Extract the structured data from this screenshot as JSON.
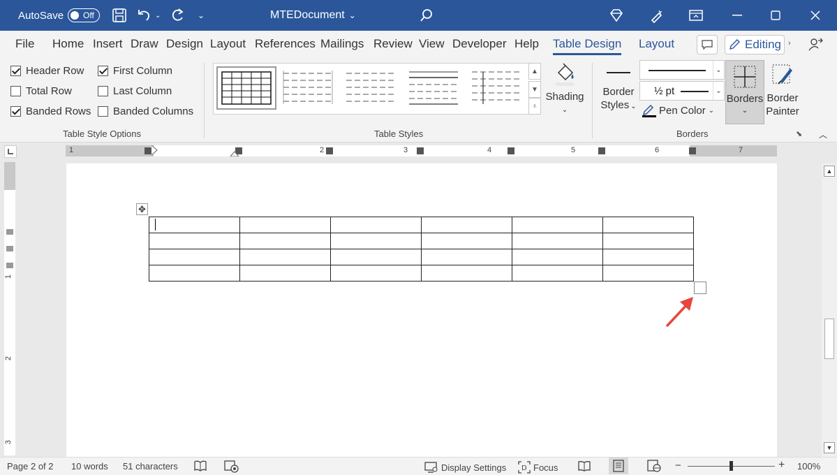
{
  "titlebar": {
    "autosave_label": "AutoSave",
    "autosave_state": "Off",
    "doc_title": "MTEDocument",
    "bg_color": "#2b579a"
  },
  "menu": {
    "tabs": [
      "File",
      "Home",
      "Insert",
      "Draw",
      "Design",
      "Layout",
      "References",
      "Mailings",
      "Review",
      "View",
      "Developer",
      "Help",
      "Table Design",
      "Layout"
    ],
    "active_tab": "Table Design",
    "editing_label": "Editing"
  },
  "ribbon": {
    "table_style_options": {
      "items": [
        {
          "label": "Header Row",
          "checked": true
        },
        {
          "label": "First Column",
          "checked": true
        },
        {
          "label": "Total Row",
          "checked": false
        },
        {
          "label": "Last Column",
          "checked": false
        },
        {
          "label": "Banded Rows",
          "checked": true
        },
        {
          "label": "Banded Columns",
          "checked": false
        }
      ],
      "group_label": "Table Style Options"
    },
    "table_styles": {
      "group_label": "Table Styles",
      "shading_label": "Shading"
    },
    "borders": {
      "border_styles_line1": "Border",
      "border_styles_line2": "Styles",
      "weight": "½ pt",
      "pen_color": "Pen Color",
      "borders_label": "Borders",
      "border_painter_line1": "Border",
      "border_painter_line2": "Painter",
      "group_label": "Borders"
    }
  },
  "ruler": {
    "h_numbers": [
      "1",
      "1",
      "2",
      "3",
      "4",
      "5",
      "6",
      "7"
    ],
    "v_numbers": [
      "1",
      "2",
      "3"
    ]
  },
  "document": {
    "table_rows": 4,
    "table_cols": 6
  },
  "statusbar": {
    "page": "Page 2 of 2",
    "words": "10 words",
    "characters": "51 characters",
    "display_settings": "Display Settings",
    "focus": "Focus",
    "zoom": "100%",
    "zoom_minus": "−",
    "zoom_plus": "+"
  }
}
